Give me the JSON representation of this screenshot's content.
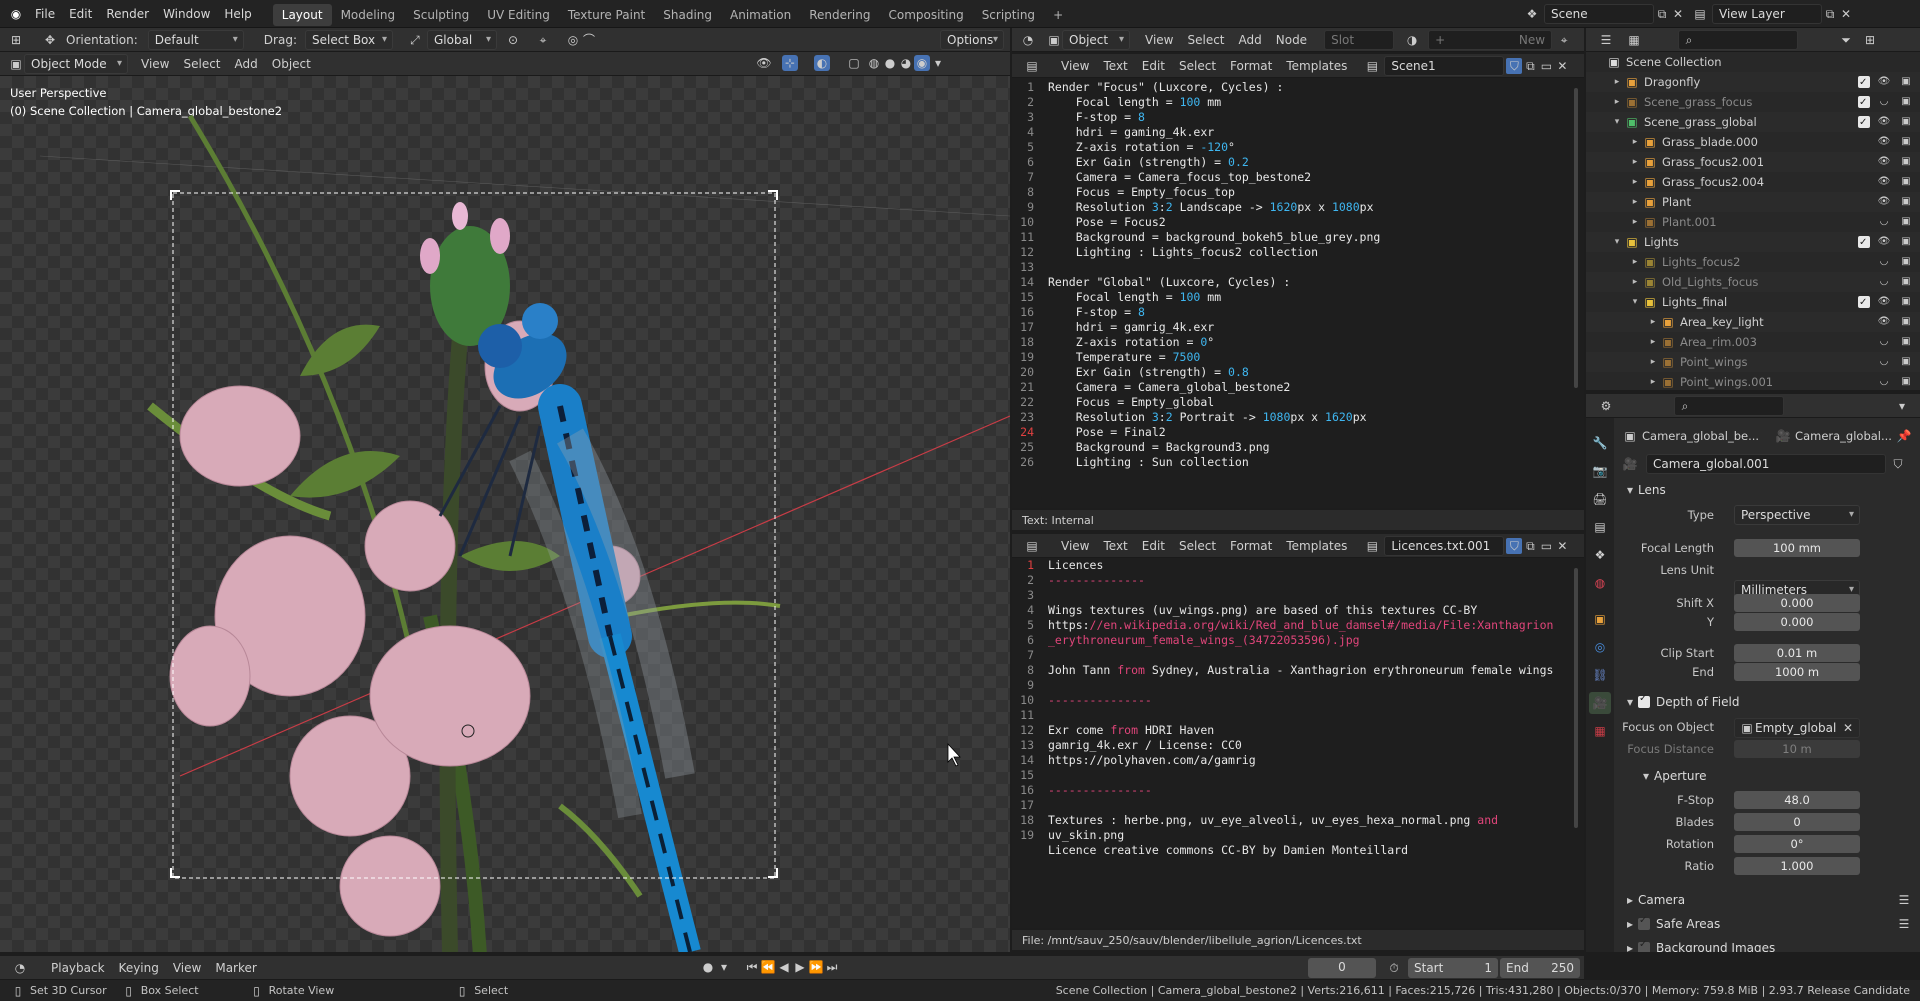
{
  "topbar": {
    "menus": [
      "File",
      "Edit",
      "Render",
      "Window",
      "Help"
    ],
    "workspaces": [
      "Layout",
      "Modeling",
      "Sculpting",
      "UV Editing",
      "Texture Paint",
      "Shading",
      "Animation",
      "Rendering",
      "Compositing",
      "Scripting"
    ],
    "active_workspace": "Layout",
    "add_tab": "+",
    "scene": "Scene",
    "view_layer": "View Layer"
  },
  "tool_header": {
    "orientation_label": "Orientation:",
    "orientation": "Default",
    "drag_label": "Drag:",
    "drag": "Select Box",
    "transform_orientation": "Global",
    "options": "Options"
  },
  "viewport": {
    "mode": "Object Mode",
    "menus": [
      "View",
      "Select",
      "Add",
      "Object"
    ],
    "perspective": "User Perspective",
    "collection_info": "(0) Scene Collection | Camera_global_bestone2"
  },
  "node_header": {
    "object": "Object",
    "menus": [
      "View",
      "Select",
      "Add",
      "Node"
    ],
    "slot": "Slot",
    "new": "New"
  },
  "text_editor_1": {
    "menus": [
      "View",
      "Text",
      "Edit",
      "Select",
      "Format",
      "Templates"
    ],
    "datablock": "Scene1",
    "status": "Text: Internal",
    "lines": [
      [
        [
          "",
          "Render \"Focus\" (Luxcore, Cycles) :"
        ]
      ],
      [
        [
          "",
          "    Focal length = "
        ],
        [
          "num",
          "100"
        ],
        [
          "",
          " mm"
        ]
      ],
      [
        [
          "",
          "    F-stop = "
        ],
        [
          "num",
          "8"
        ]
      ],
      [
        [
          "",
          "    hdri = gaming_4k.exr"
        ]
      ],
      [
        [
          "",
          "    Z-axis rotation = "
        ],
        [
          "num",
          "-120"
        ],
        [
          "",
          "°"
        ]
      ],
      [
        [
          "",
          "    Exr Gain (strength) = "
        ],
        [
          "num",
          "0.2"
        ]
      ],
      [
        [
          "",
          "    Camera = Camera_focus_top_bestone2"
        ]
      ],
      [
        [
          "",
          "    Focus = Empty_focus_top"
        ]
      ],
      [
        [
          "",
          "    Resolution "
        ],
        [
          "num",
          "3"
        ],
        [
          "",
          ":"
        ],
        [
          "num",
          "2"
        ],
        [
          "",
          " Landscape -> "
        ],
        [
          "num",
          "1620"
        ],
        [
          "",
          "px x "
        ],
        [
          "num",
          "1080"
        ],
        [
          "",
          "px"
        ]
      ],
      [
        [
          "",
          "    Pose = Focus2"
        ]
      ],
      [
        [
          "",
          "    Background = background_bokeh5_blue_grey.png"
        ]
      ],
      [
        [
          "",
          "    Lighting : Lights_focus2 collection"
        ]
      ],
      [
        [
          "",
          ""
        ]
      ],
      [
        [
          "",
          "Render \"Global\" (Luxcore, Cycles) :"
        ]
      ],
      [
        [
          "",
          "    Focal length = "
        ],
        [
          "num",
          "100"
        ],
        [
          "",
          " mm"
        ]
      ],
      [
        [
          "",
          "    F-stop = "
        ],
        [
          "num",
          "8"
        ]
      ],
      [
        [
          "",
          "    hdri = gamrig_4k.exr"
        ]
      ],
      [
        [
          "",
          "    Z-axis rotation = "
        ],
        [
          "num",
          "0"
        ],
        [
          "",
          "°"
        ]
      ],
      [
        [
          "",
          "    Temperature = "
        ],
        [
          "num",
          "7500"
        ]
      ],
      [
        [
          "",
          "    Exr Gain (strength) = "
        ],
        [
          "num",
          "0.8"
        ]
      ],
      [
        [
          "",
          "    Camera = Camera_global_bestone2"
        ]
      ],
      [
        [
          "",
          "    Focus = Empty_global"
        ]
      ],
      [
        [
          "",
          "    Resolution "
        ],
        [
          "num",
          "3"
        ],
        [
          "",
          ":"
        ],
        [
          "num",
          "2"
        ],
        [
          "",
          " Portrait -> "
        ],
        [
          "num",
          "1080"
        ],
        [
          "",
          "px x "
        ],
        [
          "num",
          "1620"
        ],
        [
          "",
          "px"
        ]
      ],
      [
        [
          "",
          "    Pose = Final2"
        ]
      ],
      [
        [
          "",
          "    Background = Background3.png"
        ]
      ],
      [
        [
          "",
          "    Lighting : Sun collection"
        ]
      ]
    ]
  },
  "text_editor_2": {
    "menus": [
      "View",
      "Text",
      "Edit",
      "Select",
      "Format",
      "Templates"
    ],
    "datablock": "Licences.txt.001",
    "status": "File: /mnt/sauv_250/sauv/blender/libellule_agrion/Licences.txt",
    "line_numbers": [
      "1",
      "2",
      "3",
      "4",
      "5",
      "",
      "6",
      "7",
      "8",
      "9",
      "10",
      "11",
      "12",
      "13",
      "14",
      "15",
      "16",
      "17",
      "",
      "18",
      "19"
    ],
    "lines": [
      [
        [
          "",
          "Licences"
        ]
      ],
      [
        [
          "kw",
          "--------------"
        ]
      ],
      [
        [
          "",
          ""
        ]
      ],
      [
        [
          "",
          "Wings textures (uv_wings.png) are based of this textures CC-BY"
        ]
      ],
      [
        [
          "",
          "https:"
        ],
        [
          "kw",
          "//en.wikipedia.org/wiki/Red_and_blue_damsel#/media/File:Xanthagrion"
        ]
      ],
      [
        [
          "kw",
          "_erythroneurum_female_wings_(34722053596).jpg"
        ]
      ],
      [
        [
          "",
          ""
        ]
      ],
      [
        [
          "",
          "John Tann "
        ],
        [
          "kw",
          "from"
        ],
        [
          "",
          " Sydney, Australia - Xanthagrion erythroneurum female wings"
        ]
      ],
      [
        [
          "",
          ""
        ]
      ],
      [
        [
          "kw",
          "---------------"
        ]
      ],
      [
        [
          "",
          ""
        ]
      ],
      [
        [
          "",
          "Exr come "
        ],
        [
          "kw",
          "from"
        ],
        [
          "",
          " HDRI Haven"
        ]
      ],
      [
        [
          "",
          "gamrig_4k.exr / License: CC0"
        ]
      ],
      [
        [
          "",
          "https://polyhaven.com/a/gamrig"
        ]
      ],
      [
        [
          "",
          ""
        ]
      ],
      [
        [
          "kw",
          "---------------"
        ]
      ],
      [
        [
          "",
          ""
        ]
      ],
      [
        [
          "",
          "Textures : herbe.png, uv_eye_alveoli, uv_eyes_hexa_normal.png "
        ],
        [
          "kw",
          "and"
        ]
      ],
      [
        [
          "",
          "uv_skin.png"
        ]
      ],
      [
        [
          "",
          "Licence creative commons CC-BY by Damien Monteillard"
        ]
      ],
      [
        [
          "",
          ""
        ]
      ]
    ]
  },
  "outliner": {
    "root": "Scene Collection",
    "rows": [
      {
        "indent": 1,
        "tri": "▸",
        "name": "Dragonfly",
        "dim": false,
        "color": "#e8a13c"
      },
      {
        "indent": 1,
        "tri": "▸",
        "name": "Scene_grass_focus",
        "dim": true,
        "color": "#e8a13c"
      },
      {
        "indent": 1,
        "tri": "▾",
        "name": "Scene_grass_global",
        "dim": false,
        "color": "#4fbf6a"
      },
      {
        "indent": 2,
        "tri": "▸",
        "name": "Grass_blade.000",
        "dim": false,
        "color": "#e8a13c"
      },
      {
        "indent": 2,
        "tri": "▸",
        "name": "Grass_focus2.001",
        "dim": false,
        "color": "#e8a13c"
      },
      {
        "indent": 2,
        "tri": "▸",
        "name": "Grass_focus2.004",
        "dim": false,
        "color": "#e8a13c"
      },
      {
        "indent": 2,
        "tri": "▸",
        "name": "Plant",
        "dim": false,
        "color": "#e8a13c"
      },
      {
        "indent": 2,
        "tri": "▸",
        "name": "Plant.001",
        "dim": true,
        "color": "#e8a13c"
      },
      {
        "indent": 1,
        "tri": "▾",
        "name": "Lights",
        "dim": false,
        "color": "#e8c13c"
      },
      {
        "indent": 2,
        "tri": "▸",
        "name": "Lights_focus2",
        "dim": true,
        "color": "#e8c13c"
      },
      {
        "indent": 2,
        "tri": "▸",
        "name": "Old_Lights_focus",
        "dim": true,
        "color": "#e8c13c"
      },
      {
        "indent": 2,
        "tri": "▾",
        "name": "Lights_final",
        "dim": false,
        "color": "#e8c13c"
      },
      {
        "indent": 3,
        "tri": "▸",
        "name": "Area_key_light",
        "dim": false,
        "color": "#e8a13c"
      },
      {
        "indent": 3,
        "tri": "▸",
        "name": "Area_rim.003",
        "dim": true,
        "color": "#e8a13c"
      },
      {
        "indent": 3,
        "tri": "▸",
        "name": "Point_wings",
        "dim": true,
        "color": "#e8a13c"
      },
      {
        "indent": 3,
        "tri": "▸",
        "name": "Point_wings.001",
        "dim": true,
        "color": "#e8a13c"
      }
    ]
  },
  "properties": {
    "breadcrumb_object": "Camera_global_be...",
    "breadcrumb_data": "Camera_global...",
    "datablock": "Camera_global.001",
    "lens_section": "Lens",
    "type_label": "Type",
    "type_value": "Perspective",
    "focal_label": "Focal Length",
    "focal_value": "100 mm",
    "lens_unit_label": "Lens Unit",
    "lens_unit_value": "Millimeters",
    "shift_x_label": "Shift X",
    "shift_x_value": "0.000",
    "shift_y_label": "Y",
    "shift_y_value": "0.000",
    "clip_start_label": "Clip Start",
    "clip_start_value": "0.01 m",
    "clip_end_label": "End",
    "clip_end_value": "1000 m",
    "dof_section": "Depth of Field",
    "focus_obj_label": "Focus on Object",
    "focus_obj_value": "Empty_global",
    "focus_dist_label": "Focus Distance",
    "focus_dist_value": "10 m",
    "aperture_section": "Aperture",
    "fstop_label": "F-Stop",
    "fstop_value": "48.0",
    "blades_label": "Blades",
    "blades_value": "0",
    "rotation_label": "Rotation",
    "rotation_value": "0°",
    "ratio_label": "Ratio",
    "ratio_value": "1.000",
    "camera_section": "Camera",
    "safe_areas_section": "Safe Areas",
    "bg_images_section": "Background Images"
  },
  "timeline": {
    "menus": [
      "Playback",
      "Keying",
      "View",
      "Marker"
    ],
    "current_frame": "0",
    "start_label": "Start",
    "start_value": "1",
    "end_label": "End",
    "end_value": "250"
  },
  "statusbar": {
    "hint1": "Set 3D Cursor",
    "hint2": "Box Select",
    "hint3": "Rotate View",
    "hint4": "Select",
    "stats": "Scene Collection | Camera_global_bestone2 | Verts:216,611 | Faces:215,726 | Tris:431,280 | Objects:0/370 | Memory: 759.8 MiB | 2.93.7 Release Candidate"
  },
  "colors": {
    "accent": "#4772b3",
    "outliner_active": "#334d80",
    "x_axis": "#c83c46"
  }
}
